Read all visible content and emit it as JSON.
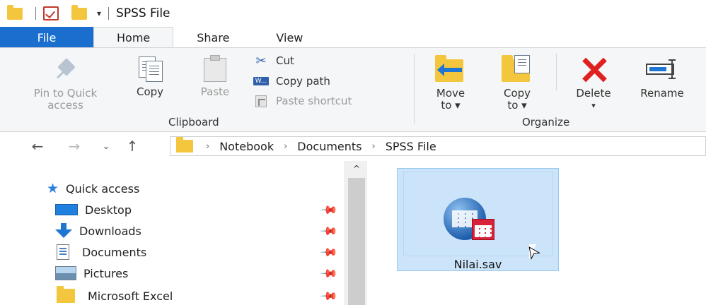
{
  "window": {
    "title": "SPSS File"
  },
  "tabs": [
    {
      "label": "File"
    },
    {
      "label": "Home"
    },
    {
      "label": "Share"
    },
    {
      "label": "View"
    }
  ],
  "ribbon": {
    "pin_label_line1": "Pin to Quick",
    "pin_label_line2": "access",
    "copy_label": "Copy",
    "paste_label": "Paste",
    "cut_label": "Cut",
    "copy_path_label": "Copy path",
    "paste_shortcut_label": "Paste shortcut",
    "clipboard_group": "Clipboard",
    "move_to_line1": "Move",
    "move_to_line2": "to ▾",
    "copy_to_line1": "Copy",
    "copy_to_line2": "to ▾",
    "delete_label": "Delete",
    "delete_arrow": "▾",
    "rename_label": "Rename",
    "organize_group": "Organize"
  },
  "address": {
    "crumbs": [
      "Notebook",
      "Documents",
      "SPSS File"
    ],
    "separator": "›"
  },
  "nav": {
    "quick_access": "Quick access",
    "items": [
      {
        "label": "Desktop"
      },
      {
        "label": "Downloads"
      },
      {
        "label": "Documents"
      },
      {
        "label": "Pictures"
      },
      {
        "label": "Microsoft Excel"
      }
    ]
  },
  "files": [
    {
      "name": "Nilai.sav"
    }
  ]
}
